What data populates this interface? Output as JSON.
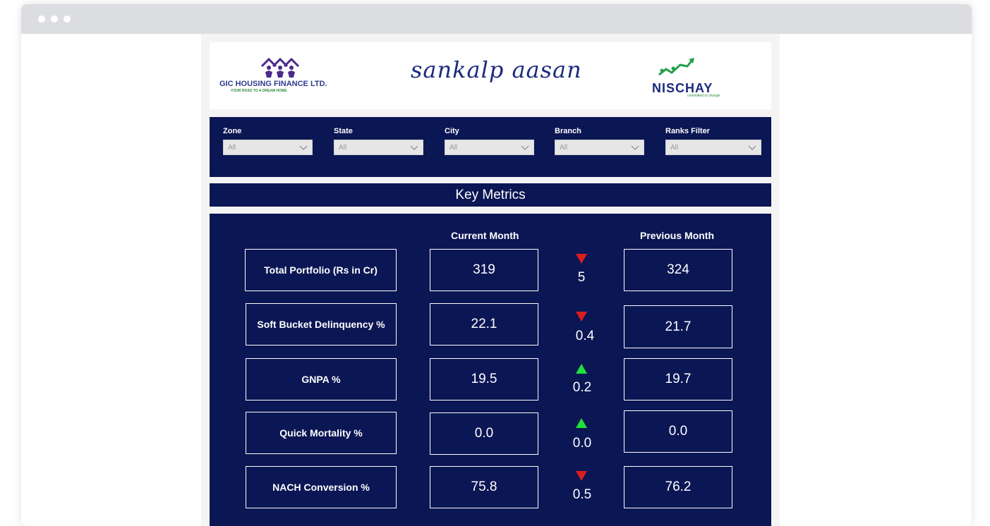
{
  "header": {
    "gic_logo": {
      "name": "GIC HOUSING FINANCE LTD.",
      "tagline": "YOUR ROAD TO A DREAM HOME",
      "icon": "houses-people-icon"
    },
    "title": "sankalp aasan",
    "nischay_logo": {
      "name": "NISCHAY",
      "tagline": "committed to change",
      "icon": "growth-arrow-icon"
    }
  },
  "filters": [
    {
      "label": "Zone",
      "value": "All"
    },
    {
      "label": "State",
      "value": "All"
    },
    {
      "label": "City",
      "value": "All"
    },
    {
      "label": "Branch",
      "value": "All"
    },
    {
      "label": "Ranks Filter",
      "value": "All"
    }
  ],
  "key_metrics": {
    "title": "Key Metrics",
    "current_header": "Current Month",
    "previous_header": "Previous Month",
    "rows": [
      {
        "label": "Total Portfolio (Rs in Cr)",
        "current": "319",
        "change": "5",
        "direction": "down",
        "previous": "324"
      },
      {
        "label": "Soft Bucket Delinquency %",
        "current": "22.1",
        "change": "0.4",
        "direction": "down",
        "previous": "21.7"
      },
      {
        "label": "GNPA %",
        "current": "19.5",
        "change": "0.2",
        "direction": "up",
        "previous": "19.7"
      },
      {
        "label": "Quick Mortality %",
        "current": "0.0",
        "change": "0.0",
        "direction": "up",
        "previous": "0.0"
      },
      {
        "label": "NACH Conversion %",
        "current": "75.8",
        "change": "0.5",
        "direction": "down",
        "previous": "76.2"
      }
    ]
  },
  "colors": {
    "navy": "#0b1654",
    "up": "#22e03a",
    "down": "#d81e1e"
  }
}
